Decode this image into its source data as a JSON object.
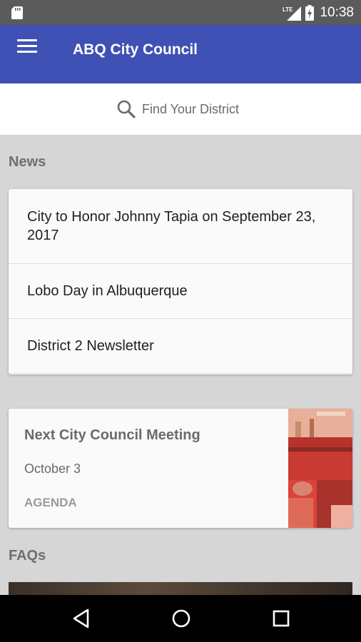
{
  "status_bar": {
    "time": "10:38",
    "network_label": "LTE",
    "icons": [
      "sd-card-icon",
      "lte-signal-icon",
      "battery-charging-icon"
    ]
  },
  "app_bar": {
    "title": "ABQ City Council",
    "menu_icon": "hamburger-menu-icon",
    "color": "#3f51b5"
  },
  "search": {
    "placeholder": "Find Your District",
    "icon": "search-icon"
  },
  "news": {
    "heading": "News",
    "items": [
      {
        "title": "City to Honor Johnny Tapia on September 23, 2017"
      },
      {
        "title": "Lobo Day in Albuquerque"
      },
      {
        "title": "District 2 Newsletter"
      }
    ]
  },
  "meeting": {
    "title": "Next City Council Meeting",
    "date": "October 3",
    "action_label": "AGENDA",
    "image": "council-chamber-photo"
  },
  "faqs": {
    "heading": "FAQs"
  },
  "nav_bar": {
    "icons": [
      "back-icon",
      "home-icon",
      "recents-icon"
    ]
  },
  "colors": {
    "primary": "#3f51b5",
    "status_bar": "#5b5b5b",
    "background": "#d6d6d6",
    "card": "#fafafa"
  }
}
